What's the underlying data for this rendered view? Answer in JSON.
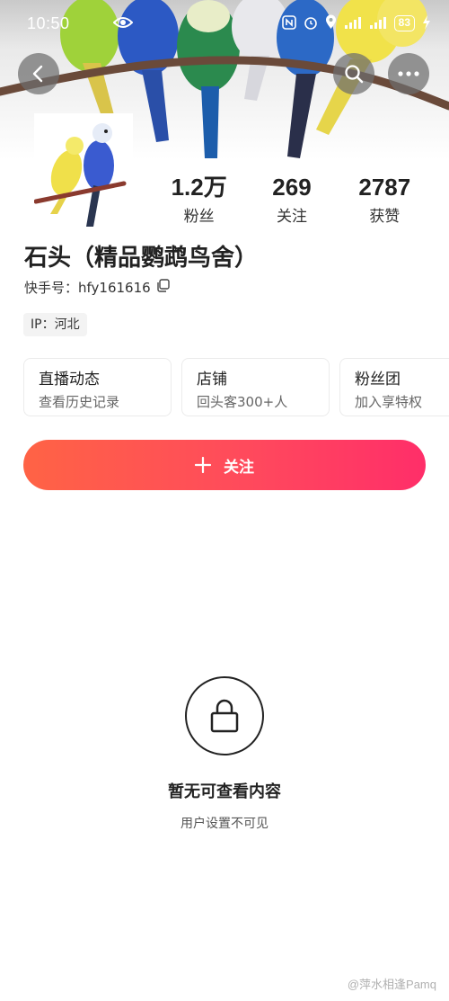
{
  "status_bar": {
    "time": "10:50",
    "battery": "83"
  },
  "profile": {
    "name": "石头（精品鹦鹉鸟舍）",
    "kuaishou_id_label": "快手号：",
    "kuaishou_id": "hfy161616",
    "ip": "IP：河北",
    "stats": [
      {
        "value": "1.2万",
        "label": "粉丝"
      },
      {
        "value": "269",
        "label": "关注"
      },
      {
        "value": "2787",
        "label": "获赞"
      }
    ]
  },
  "cards": [
    {
      "title": "直播动态",
      "subtitle": "查看历史记录"
    },
    {
      "title": "店铺",
      "subtitle": "回头客300+人"
    },
    {
      "title": "粉丝团",
      "subtitle": "加入享特权"
    }
  ],
  "follow_button": {
    "icon": "plus-icon",
    "label": "关注"
  },
  "empty_state": {
    "icon": "lock-icon",
    "title": "暂无可查看内容",
    "subtitle": "用户设置不可见"
  },
  "watermark": "@萍水相逢Pamq",
  "colors": {
    "follow_gradient_start": "#ff6345",
    "follow_gradient_end": "#ff2e69"
  }
}
